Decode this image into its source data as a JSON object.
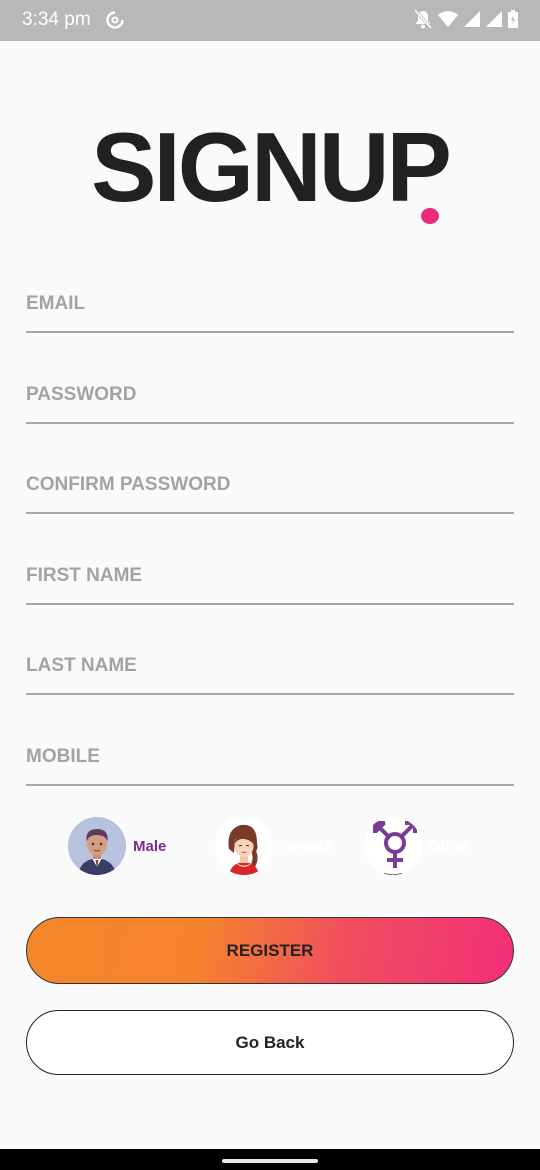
{
  "status_bar": {
    "time": "3:34 pm",
    "icons": [
      "sync-icon",
      "notifications-off-icon",
      "wifi-icon",
      "signal-icon",
      "signal-icon",
      "battery-icon"
    ]
  },
  "page": {
    "title": "SIGNUP",
    "accent_color": "#ec2a7a"
  },
  "form": {
    "email": {
      "placeholder": "EMAIL",
      "value": ""
    },
    "password": {
      "placeholder": "PASSWORD",
      "value": ""
    },
    "confirm_password": {
      "placeholder": "CONFIRM PASSWORD",
      "value": ""
    },
    "first_name": {
      "placeholder": "FIRST NAME",
      "value": ""
    },
    "last_name": {
      "placeholder": "LAST NAME",
      "value": ""
    },
    "mobile": {
      "placeholder": "MOBILE",
      "value": ""
    }
  },
  "gender": {
    "options": [
      {
        "label": "Male",
        "icon": "male-avatar-icon",
        "color": "#7b2c8f",
        "selected": true
      },
      {
        "label": "Female",
        "icon": "female-avatar-icon",
        "color": "#ffffff",
        "selected": false
      },
      {
        "label": "Other",
        "icon": "transgender-symbol-icon",
        "color": "#ffffff",
        "selected": false
      }
    ]
  },
  "actions": {
    "register_label": "REGISTER",
    "back_label": "Go Back"
  },
  "colors": {
    "gradient_start": "#f4862a",
    "gradient_end": "#f22e78",
    "gender_selected": "#7b2c8f"
  }
}
